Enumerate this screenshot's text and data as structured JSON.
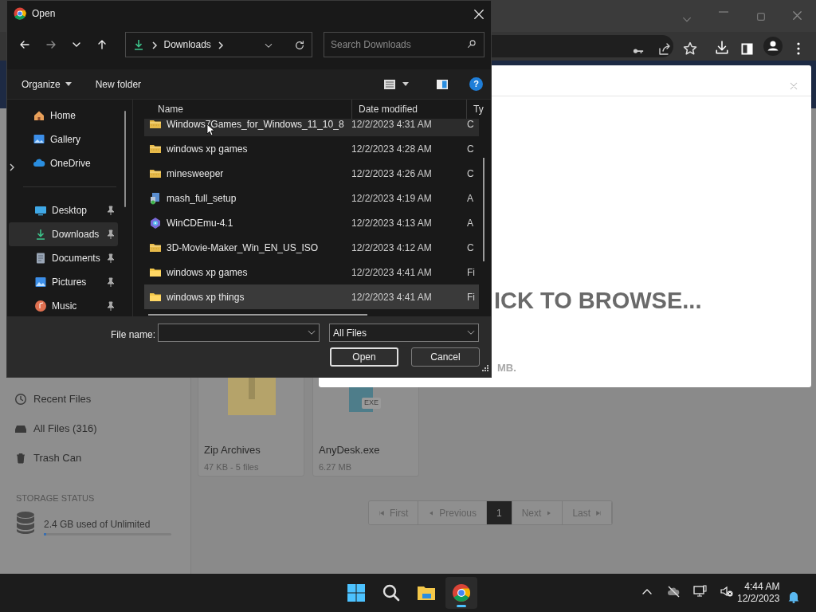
{
  "browser": {
    "page": {
      "sidebar": [
        {
          "label": "Recent Files",
          "kind": "clock"
        },
        {
          "label": "All Files (316)",
          "kind": "drive"
        },
        {
          "label": "Trash Can",
          "kind": "trash"
        }
      ],
      "storage": {
        "heading": "STORAGE STATUS",
        "text": "2.4 GB used of Unlimited",
        "level": 0.02
      },
      "cards": [
        {
          "title": "Zip Archives",
          "meta": "47 KB - 5 files",
          "kind": "zip"
        },
        {
          "title": "AnyDesk.exe",
          "meta": "6.27 MB",
          "kind": "exe",
          "badge": "EXE"
        }
      ],
      "pagination": [
        {
          "label": "First",
          "kind": "first",
          "selected": false
        },
        {
          "label": "Previous",
          "kind": "previous",
          "selected": false
        },
        {
          "label": "1",
          "kind": "page",
          "selected": true
        },
        {
          "label": "Next",
          "kind": "next",
          "selected": false
        },
        {
          "label": "Last",
          "kind": "last",
          "selected": false
        }
      ],
      "modal": {
        "heading": "ICK TO BROWSE...",
        "note": "MB."
      }
    }
  },
  "dialog": {
    "title": "Open",
    "nav_buttons": [
      {
        "kind": "back",
        "disabled": false
      },
      {
        "kind": "forward",
        "disabled": true
      },
      {
        "kind": "recent",
        "disabled": false
      },
      {
        "kind": "up",
        "disabled": false
      }
    ],
    "address": {
      "segments": [
        "Downloads"
      ]
    },
    "search": {
      "placeholder": "Search Downloads"
    },
    "toolbar": {
      "organize": "Organize",
      "new_folder": "New folder",
      "help": "?"
    },
    "sidebar": [
      {
        "label": "Home",
        "kind": "home",
        "pinned": false,
        "selected": false,
        "expandable": false
      },
      {
        "label": "Gallery",
        "kind": "gallery",
        "pinned": false,
        "selected": false,
        "expandable": false
      },
      {
        "label": "OneDrive",
        "kind": "cloud",
        "pinned": false,
        "selected": false,
        "expandable": true
      },
      {
        "kind": "separator"
      },
      {
        "label": "Desktop",
        "kind": "desktop",
        "pinned": true,
        "selected": false,
        "expandable": false
      },
      {
        "label": "Downloads",
        "kind": "downloads",
        "pinned": true,
        "selected": true,
        "expandable": false
      },
      {
        "label": "Documents",
        "kind": "documents",
        "pinned": true,
        "selected": false,
        "expandable": false
      },
      {
        "label": "Pictures",
        "kind": "pictures",
        "pinned": true,
        "selected": false,
        "expandable": false
      },
      {
        "label": "Music",
        "kind": "music",
        "pinned": true,
        "selected": false,
        "expandable": false
      }
    ],
    "columns": [
      "Name",
      "Date modified",
      "Ty"
    ],
    "rows": [
      {
        "name": "Windows7Games_for_Windows_11_10_8",
        "date": "12/2/2023 4:31 AM",
        "type": "C",
        "kind": "zip-folder",
        "hovered": true,
        "selected": false
      },
      {
        "name": "windows xp games",
        "date": "12/2/2023 4:28 AM",
        "type": "C",
        "kind": "zip-folder",
        "hovered": false,
        "selected": false
      },
      {
        "name": "minesweeper",
        "date": "12/2/2023 4:26 AM",
        "type": "C",
        "kind": "zip-folder",
        "hovered": false,
        "selected": false
      },
      {
        "name": "mash_full_setup",
        "date": "12/2/2023 4:19 AM",
        "type": "A",
        "kind": "installer",
        "hovered": false,
        "selected": false
      },
      {
        "name": "WinCDEmu-4.1",
        "date": "12/2/2023 4:13 AM",
        "type": "A",
        "kind": "disc-app",
        "hovered": false,
        "selected": false
      },
      {
        "name": "3D-Movie-Maker_Win_EN_US_ISO",
        "date": "12/2/2023 4:12 AM",
        "type": "C",
        "kind": "zip-folder",
        "hovered": false,
        "selected": false
      },
      {
        "name": "windows xp games",
        "date": "12/2/2023 4:41 AM",
        "type": "Fi",
        "kind": "folder",
        "hovered": false,
        "selected": false
      },
      {
        "name": "windows xp things",
        "date": "12/2/2023 4:41 AM",
        "type": "Fi",
        "kind": "folder",
        "hovered": false,
        "selected": true
      }
    ],
    "file_name_label": "File name:",
    "file_type": "All Files",
    "buttons": [
      {
        "label": "Open",
        "default": true
      },
      {
        "label": "Cancel",
        "default": false
      }
    ]
  },
  "taskbar": {
    "apps": [
      {
        "kind": "start",
        "active": false
      },
      {
        "kind": "search",
        "active": false
      },
      {
        "kind": "explorer",
        "active": false
      },
      {
        "kind": "chrome",
        "active": true
      }
    ],
    "time": "4:44 AM",
    "date": "12/2/2023"
  }
}
